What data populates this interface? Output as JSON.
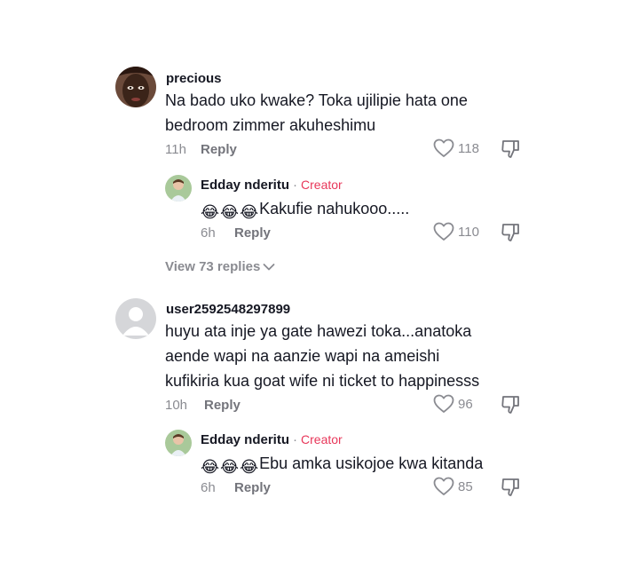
{
  "comments": [
    {
      "username": "precious",
      "text_lines": [
        "Na bado uko kwake? Toka ujilipie hata one",
        "bedroom zimmer akuheshimu"
      ],
      "time": "11h",
      "reply_label": "Reply",
      "likes": "118",
      "avatar_icon": "user-photo-icon",
      "reply": {
        "username": "Edday nderitu",
        "separator": "·",
        "badge": "Creator",
        "emojis": [
          "😂",
          "😂",
          "😂"
        ],
        "text": "Kakufie nahukooo.....",
        "time": "6h",
        "reply_label": "Reply",
        "likes": "110"
      },
      "view_replies": "View 73 replies"
    },
    {
      "username": "user2592548297899",
      "text_lines": [
        "huyu ata inje ya gate hawezi toka...anatoka",
        "aende wapi na aanzie wapi na ameishi",
        "kufikiria kua goat wife ni ticket to happinesss"
      ],
      "time": "10h",
      "reply_label": "Reply",
      "likes": "96",
      "avatar_icon": "default-avatar-icon",
      "reply": {
        "username": "Edday nderitu",
        "separator": "·",
        "badge": "Creator",
        "emojis": [
          "😂",
          "😂",
          "😂"
        ],
        "text": "Ebu amka usikojoe kwa kitanda",
        "time": "6h",
        "reply_label": "Reply",
        "likes": "85"
      }
    }
  ],
  "colors": {
    "creator_badge": "#e8375a",
    "meta_text": "#8a8b91",
    "primary_text": "#161823"
  }
}
